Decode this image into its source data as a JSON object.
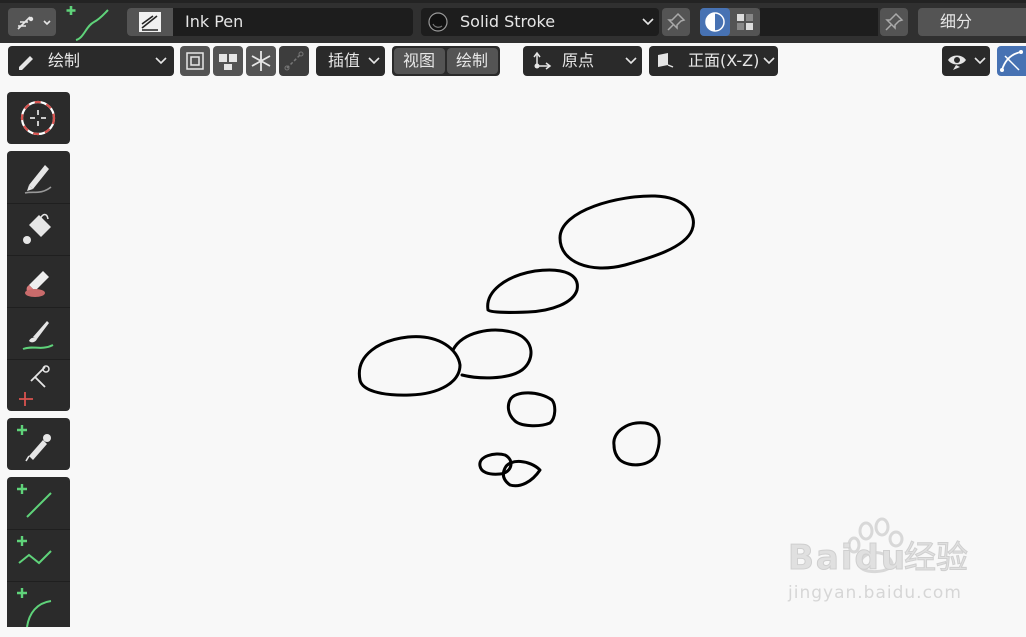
{
  "header": {
    "brush_name": "Ink Pen",
    "material_name": "Solid Stroke",
    "subdivide_label": "细分"
  },
  "toolbar": {
    "mode_label": "绘制",
    "interpolate_label": "插值",
    "view_label": "视图",
    "draw_label": "绘制",
    "pivot_label": "原点",
    "plane_label": "正面(X-Z)"
  },
  "tools": [
    {
      "name": "cursor",
      "icon": "cursor-icon"
    },
    {
      "name": "draw",
      "icon": "pencil-icon"
    },
    {
      "name": "fill",
      "icon": "fill-bucket-icon"
    },
    {
      "name": "erase",
      "icon": "eraser-icon"
    },
    {
      "name": "tint",
      "icon": "tint-brush-icon"
    },
    {
      "name": "cutter",
      "icon": "cutter-icon"
    },
    {
      "name": "eyedropper",
      "icon": "eyedropper-icon"
    },
    {
      "name": "line",
      "icon": "line-icon"
    },
    {
      "name": "polyline",
      "icon": "polyline-icon"
    },
    {
      "name": "arc",
      "icon": "arc-icon"
    }
  ],
  "watermark": {
    "brand": "Baidu",
    "brand_cn": "经验",
    "url": "jingyan.baidu.com"
  },
  "colors": {
    "header_bg": "#303030",
    "canvas_bg": "#f8f8f8",
    "active_blue": "#4772b3",
    "tool_green": "#5fd37a",
    "stroke": "#000000"
  }
}
